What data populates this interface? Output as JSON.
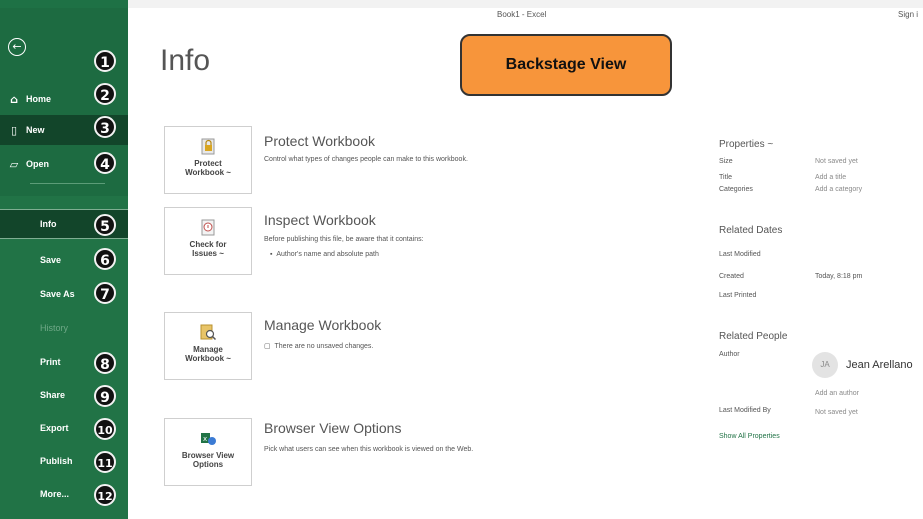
{
  "window": {
    "title": "Book1 - Excel",
    "sign_in": "Sign i"
  },
  "sidebar": {
    "back_icon": "back-arrow-icon",
    "items": [
      {
        "label": "Home",
        "icon": "home-icon",
        "badge": "1"
      },
      {
        "label": "New",
        "icon": "new-document-icon",
        "badge": "2"
      },
      {
        "label": "Open",
        "icon": "folder-open-icon",
        "badge": "3"
      },
      {
        "label": "Info",
        "badge": "4"
      },
      {
        "label": "Save",
        "badge": "5"
      },
      {
        "label": "Save As",
        "badge": "6"
      },
      {
        "label": "History",
        "badge": ""
      },
      {
        "label": "Print",
        "badge": "7"
      },
      {
        "label": "Share",
        "badge": "8"
      },
      {
        "label": "Export",
        "badge": "9"
      },
      {
        "label": "Publish",
        "badge": "10"
      },
      {
        "label": "More...",
        "badge": "11"
      }
    ],
    "badges": [
      "1",
      "2",
      "3",
      "4",
      "5",
      "6",
      "7",
      "8",
      "9",
      "10",
      "11",
      "12"
    ],
    "colors": {
      "sidebar": "#217346",
      "selected": "#12452a"
    }
  },
  "main": {
    "title": "Info",
    "callout": "Backstage View",
    "sections": [
      {
        "tile_label_1": "Protect",
        "tile_label_2": "Workbook ~",
        "title": "Protect Workbook",
        "desc": "Control what types of changes people can make to this workbook.",
        "icon": "lock-document-icon"
      },
      {
        "tile_label_1": "Check for",
        "tile_label_2": "Issues ~",
        "title": "Inspect Workbook",
        "desc": "Before publishing this file, be aware that it contains:",
        "bullet": "Author's name and absolute path",
        "icon": "inspect-document-icon"
      },
      {
        "tile_label_1": "Manage",
        "tile_label_2": "Workbook ~",
        "title": "Manage Workbook",
        "desc": "There are no unsaved changes.",
        "icon": "manage-workbook-icon"
      },
      {
        "tile_label_1": "Browser View",
        "tile_label_2": "Options",
        "title": "Browser View Options",
        "desc": "Pick what users can see when this workbook is viewed on the Web.",
        "icon": "browser-view-icon"
      }
    ]
  },
  "properties": {
    "heading": "Properties ~",
    "size_label": "Size",
    "size_value": "Not saved yet",
    "title_label": "Title",
    "title_value": "Add a title",
    "categories_label": "Categories",
    "categories_value": "Add a category",
    "dates_heading": "Related Dates",
    "last_modified_label": "Last Modified",
    "created_label": "Created",
    "created_value": "Today, 8:18 pm",
    "last_printed_label": "Last Printed",
    "people_heading": "Related People",
    "author_label": "Author",
    "author_initials": "JA",
    "author_name": "Jean Arellano",
    "add_author": "Add an author",
    "last_modified_by_label": "Last Modified By",
    "last_modified_by_value": "Not saved yet",
    "show_all": "Show All Properties"
  }
}
